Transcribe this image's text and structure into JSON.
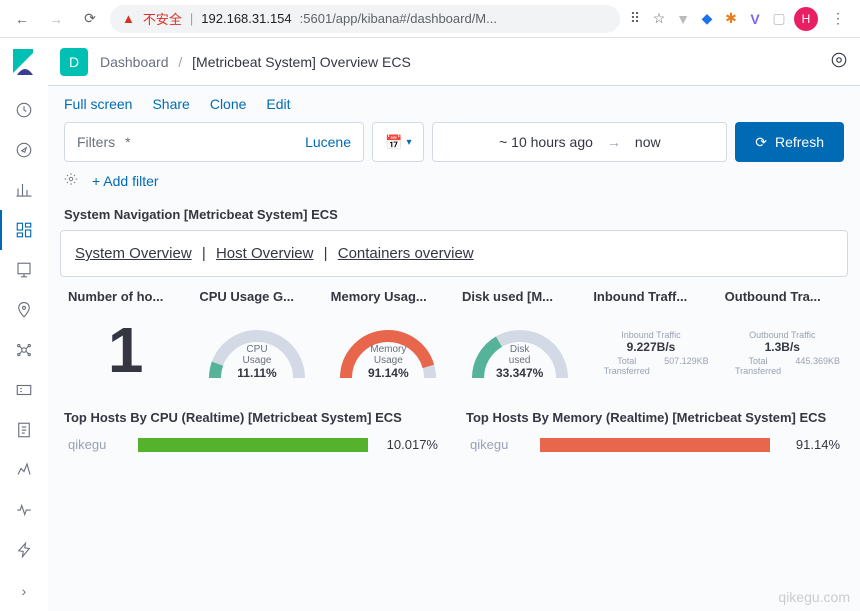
{
  "browser": {
    "insecure_label": "不安全",
    "url_host": "192.168.31.154",
    "url_rest": ":5601/app/kibana#/dashboard/M...",
    "avatar_letter": "H"
  },
  "header": {
    "badge": "D",
    "crumb_root": "Dashboard",
    "crumb_current": "[Metricbeat System] Overview ECS"
  },
  "actions": {
    "fullscreen": "Full screen",
    "share": "Share",
    "clone": "Clone",
    "edit": "Edit"
  },
  "filterbar": {
    "label": "Filters",
    "query": "*",
    "lang": "Lucene",
    "time_from": "~ 10 hours ago",
    "time_to": "now",
    "refresh": "Refresh",
    "add_filter": "+ Add filter"
  },
  "nav_panel": {
    "title": "System Navigation [Metricbeat System] ECS",
    "links": [
      "System Overview",
      "Host Overview",
      "Containers overview"
    ]
  },
  "metrics": {
    "hosts": {
      "title": "Number of ho...",
      "value": "1"
    },
    "cpu": {
      "title": "CPU Usage G...",
      "label": "CPU Usage",
      "value": "11.11%",
      "frac": 0.111,
      "color": "#54b399"
    },
    "memory": {
      "title": "Memory Usag...",
      "label": "Memory Usage",
      "value": "91.14%",
      "frac": 0.911,
      "color": "#e7664c"
    },
    "disk": {
      "title": "Disk used [M...",
      "label": "Disk used",
      "value": "33.347%",
      "frac": 0.333,
      "color": "#54b399"
    },
    "inbound": {
      "title": "Inbound Traff...",
      "label": "Inbound Traffic",
      "rate": "9.227B/s",
      "total_label": "Total Transferred",
      "total": "507.129KB"
    },
    "outbound": {
      "title": "Outbound Tra...",
      "label": "Outbound Traffic",
      "rate": "1.3B/s",
      "total_label": "Total Transferred",
      "total": "445.369KB"
    }
  },
  "top_cpu": {
    "title": "Top Hosts By CPU (Realtime) [Metricbeat System] ECS",
    "host": "qikegu",
    "value": "10.017%",
    "frac": 1.0,
    "color": "#54b22d"
  },
  "top_mem": {
    "title": "Top Hosts By Memory (Realtime) [Metricbeat System] ECS",
    "host": "qikegu",
    "value": "91.14%",
    "frac": 1.0,
    "color": "#e7664c"
  },
  "watermark": "qikegu.com",
  "chart_data": [
    {
      "type": "gauge",
      "title": "CPU Usage",
      "values": [
        11.11
      ],
      "ylim": [
        0,
        100
      ],
      "unit": "%"
    },
    {
      "type": "gauge",
      "title": "Memory Usage",
      "values": [
        91.14
      ],
      "ylim": [
        0,
        100
      ],
      "unit": "%"
    },
    {
      "type": "gauge",
      "title": "Disk used",
      "values": [
        33.347
      ],
      "ylim": [
        0,
        100
      ],
      "unit": "%"
    },
    {
      "type": "bar",
      "title": "Top Hosts By CPU (Realtime)",
      "categories": [
        "qikegu"
      ],
      "values": [
        10.017
      ],
      "unit": "%"
    },
    {
      "type": "bar",
      "title": "Top Hosts By Memory (Realtime)",
      "categories": [
        "qikegu"
      ],
      "values": [
        91.14
      ],
      "unit": "%"
    }
  ]
}
